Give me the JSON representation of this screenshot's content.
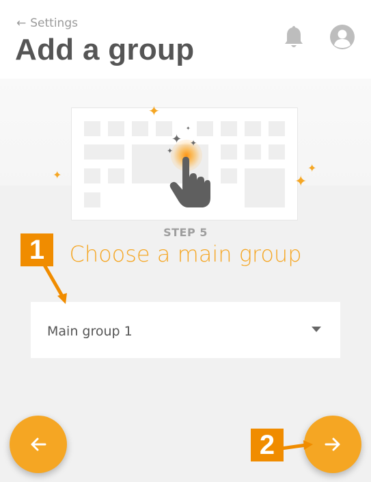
{
  "header": {
    "back_label": "Settings",
    "title": "Add a group",
    "notifications_icon": "bell-icon",
    "profile_icon": "user-avatar-icon"
  },
  "step": {
    "label": "STEP 5",
    "title": "Choose a main group"
  },
  "main_group_select": {
    "selected": "Main group 1"
  },
  "navigation": {
    "prev_icon": "arrow-left-icon",
    "next_icon": "arrow-right-icon"
  },
  "callouts": [
    "1",
    "2"
  ],
  "colors": {
    "accent": "#f5a623",
    "callout": "#f08c00",
    "title_text": "#555555",
    "muted_text": "#9e9e9e",
    "background": "#f1f1f1"
  }
}
